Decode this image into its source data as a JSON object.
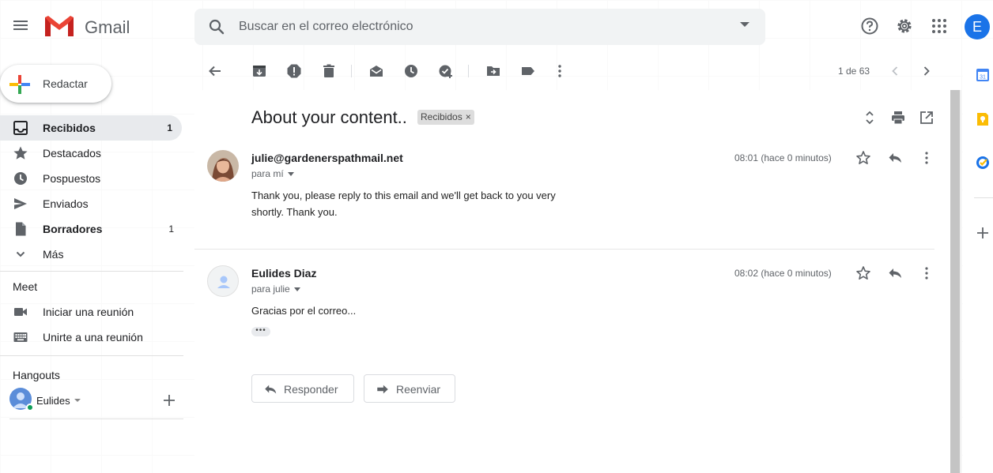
{
  "header": {
    "app_name": "Gmail",
    "search_placeholder": "Buscar en el correo electrónico",
    "account_initial": "E"
  },
  "sidebar": {
    "compose_label": "Redactar",
    "items": [
      {
        "label": "Recibidos",
        "count": "1",
        "icon": "inbox-icon",
        "active": true,
        "bold": true
      },
      {
        "label": "Destacados",
        "count": "",
        "icon": "star-icon",
        "active": false,
        "bold": false
      },
      {
        "label": "Pospuestos",
        "count": "",
        "icon": "clock-icon",
        "active": false,
        "bold": false
      },
      {
        "label": "Enviados",
        "count": "",
        "icon": "send-icon",
        "active": false,
        "bold": false
      },
      {
        "label": "Borradores",
        "count": "1",
        "icon": "draft-icon",
        "active": false,
        "bold": true
      },
      {
        "label": "Más",
        "count": "",
        "icon": "chevron-down-icon",
        "active": false,
        "bold": false
      }
    ],
    "meet": {
      "title": "Meet",
      "items": [
        {
          "label": "Iniciar una reunión",
          "icon": "video-icon"
        },
        {
          "label": "Unirte a una reunión",
          "icon": "keyboard-icon"
        }
      ]
    },
    "hangouts": {
      "title": "Hangouts",
      "user_name": "Eulides"
    }
  },
  "toolbar": {
    "pager": "1 de 63"
  },
  "email": {
    "subject": "About your content..",
    "label_chip": "Recibidos",
    "messages": [
      {
        "sender": "julie@gardenerspathmail.net",
        "to": "para mí",
        "time": "08:01 (hace 0 minutos)",
        "body_line1": "Thank you, please reply to this email and we'll get back to you very",
        "body_line2": "shortly. Thank you."
      },
      {
        "sender": "Eulides Diaz",
        "to": "para julie",
        "time": "08:02 (hace 0 minutos)",
        "body_line1": "Gracias por el correo...",
        "body_line2": ""
      }
    ],
    "ellipsis": "•••",
    "reply_label": "Responder",
    "forward_label": "Reenviar"
  },
  "colors": {
    "accent_blue": "#1a73e8",
    "active_nav_bg": "#e8eaed",
    "online_green": "#0f9d58"
  }
}
